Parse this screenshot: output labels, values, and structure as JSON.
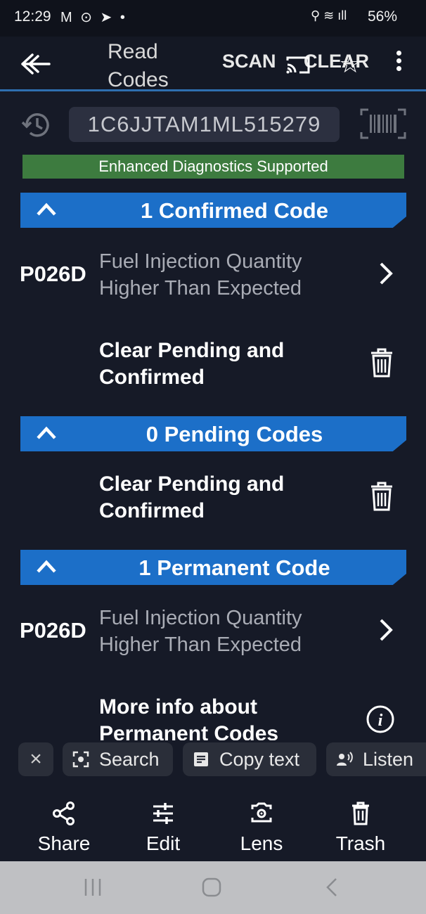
{
  "status_bar": {
    "time": "12:29",
    "left_icons": "M ⊙ ➤ •",
    "right_icons": "⚲ ≋ ıll",
    "battery": "56%"
  },
  "app_bar": {
    "title": "Read Codes",
    "scan_label": "SCAN",
    "clear_label": "CLEAR",
    "accent_color": "#2f6fb0"
  },
  "vin": {
    "value": "1C6JJTAM1ML515279"
  },
  "enhanced_banner": "Enhanced Diagnostics Supported",
  "sections": {
    "confirmed": {
      "title": "1 Confirmed Code",
      "code": "P026D",
      "description": "Fuel Injection Quantity Higher Than Expected",
      "action": "Clear Pending and Confirmed"
    },
    "pending": {
      "title": "0 Pending Codes",
      "action": "Clear Pending and Confirmed"
    },
    "permanent": {
      "title": "1 Permanent Code",
      "code": "P026D",
      "description": "Fuel Injection Quantity Higher Than Expected",
      "more_info": "More info about Permanent Codes"
    }
  },
  "lens_chips": {
    "close": "×",
    "search": "Search",
    "copy_text": "Copy text",
    "listen": "Listen"
  },
  "bottom_actions": {
    "share": "Share",
    "edit": "Edit",
    "lens": "Lens",
    "trash": "Trash"
  },
  "colors": {
    "section_blue": "#1c6fc8",
    "banner_green": "#3d7b3f",
    "background": "#161a27"
  }
}
